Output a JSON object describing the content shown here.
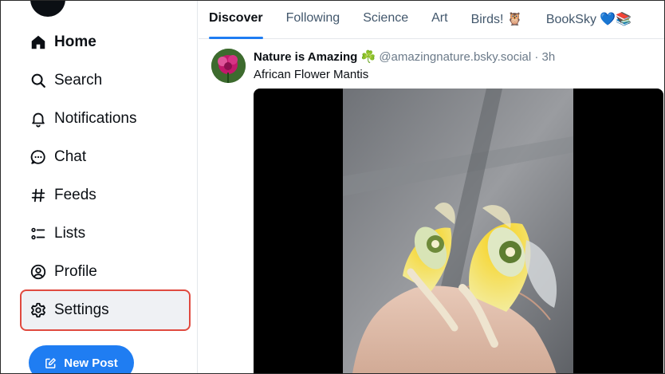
{
  "sidebar": {
    "items": [
      {
        "label": "Home",
        "icon": "home-icon"
      },
      {
        "label": "Search",
        "icon": "search-icon"
      },
      {
        "label": "Notifications",
        "icon": "bell-icon"
      },
      {
        "label": "Chat",
        "icon": "chat-bubble-icon"
      },
      {
        "label": "Feeds",
        "icon": "hash-icon"
      },
      {
        "label": "Lists",
        "icon": "list-icon"
      },
      {
        "label": "Profile",
        "icon": "profile-icon"
      },
      {
        "label": "Settings",
        "icon": "gear-icon"
      }
    ],
    "new_post_label": "New Post"
  },
  "tabs": [
    {
      "label": "Discover"
    },
    {
      "label": "Following"
    },
    {
      "label": "Science"
    },
    {
      "label": "Art"
    },
    {
      "label": "Birds! 🦉"
    },
    {
      "label": "BookSky 💙📚"
    }
  ],
  "post": {
    "author": "Nature is Amazing ☘️",
    "handle_time": "@amazingnature.bsky.social · 3h",
    "text": "African Flower Mantis"
  },
  "colors": {
    "accent": "#1f7df2",
    "highlight_border": "#e04a3f"
  }
}
